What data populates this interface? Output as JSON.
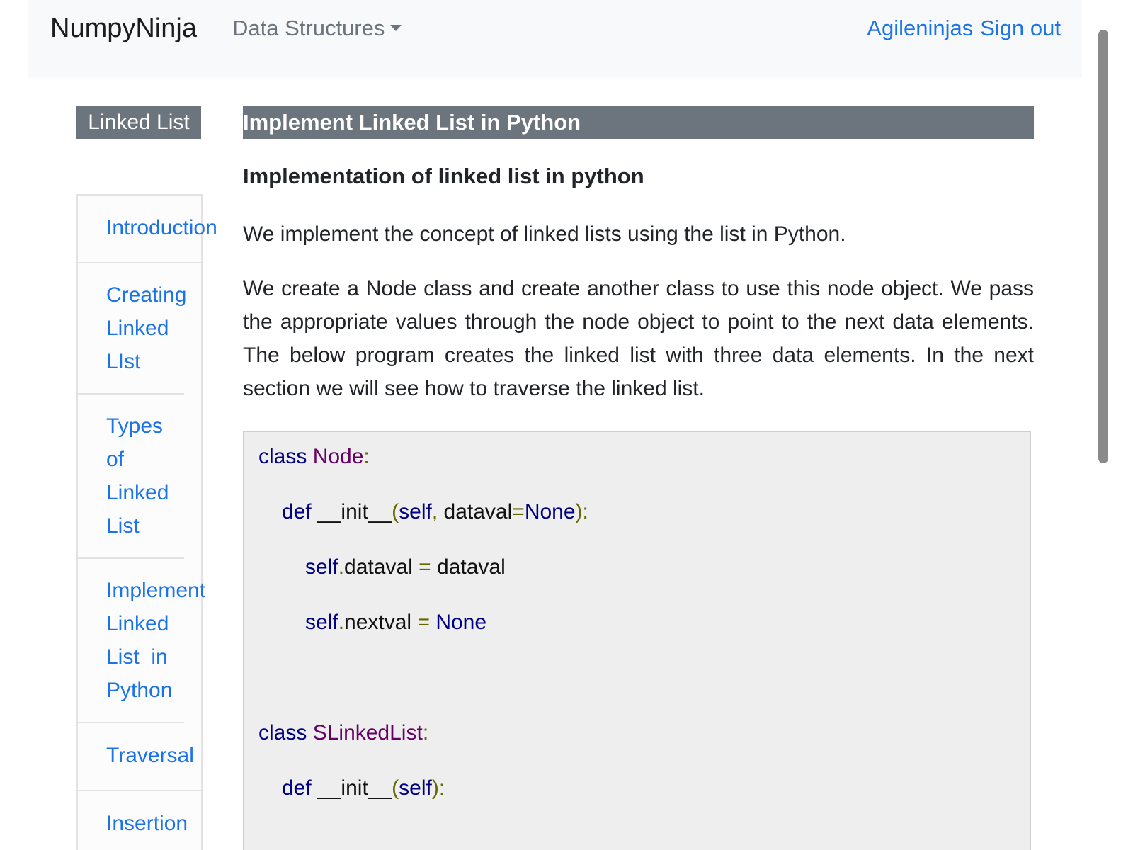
{
  "navbar": {
    "brand": "NumpyNinja",
    "dropdown_label": "Data Structures",
    "user_label": "Agileninjas",
    "signout_label": "Sign out"
  },
  "sidebar": {
    "title": "Linked List",
    "items": [
      {
        "label": "Introduction"
      },
      {
        "label": "Creating Linked LIst"
      },
      {
        "label": "Types of Linked List"
      },
      {
        "label": "Implement Linked List  in Python"
      },
      {
        "label": "Traversal"
      },
      {
        "label": "Insertion"
      }
    ]
  },
  "main": {
    "title": "Implement Linked List in Python",
    "subheading": "Implementation of linked list in python",
    "paragraph1": "We implement the concept of linked lists using the list in Python.",
    "paragraph2": "We create a Node class and create another class to use this node object. We pass the appropriate values through the node object to point to the next data elements. The below program creates the linked list with three data elements. In the next section we will see how to traverse the linked list."
  },
  "code": {
    "l1_kw": "class",
    "l1_name": "Node",
    "l1_colon": ":",
    "l2_def": "def",
    "l2_init": "__init__",
    "l2_open": "(",
    "l2_self": "self",
    "l2_comma": ",",
    "l2_param": "dataval",
    "l2_eq": "=",
    "l2_none": "None",
    "l2_close": "):",
    "l3_self": "self",
    "l3_dot": ".",
    "l3_attr": "dataval",
    "l3_eq": "=",
    "l3_val": "dataval",
    "l4_self": "self",
    "l4_dot": ".",
    "l4_attr": "nextval",
    "l4_eq": "=",
    "l4_val": "None",
    "l5_kw": "class",
    "l5_name": "SLinkedList",
    "l5_colon": ":",
    "l6_def": "def",
    "l6_init": "__init__",
    "l6_open": "(",
    "l6_self": "self",
    "l6_close": "):"
  },
  "colors": {
    "brand_text": "#1c1c1c",
    "nav_bg": "#f8f9fa",
    "link": "#1a73e8",
    "title_bg": "#6c757d",
    "code_bg": "#eeeeee",
    "keyword": "#000080",
    "class_name": "#660066",
    "punctuation": "#666600"
  }
}
